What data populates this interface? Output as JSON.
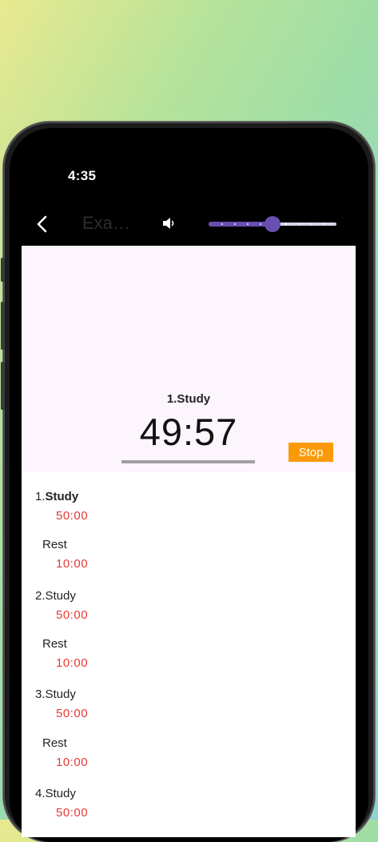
{
  "status": {
    "time": "4:35"
  },
  "appbar": {
    "title": "Exam...",
    "volume_level": 0.5
  },
  "timer": {
    "current_label": "1.Study",
    "countdown": "49:57",
    "stop_label": "Stop"
  },
  "list": [
    {
      "title": "1.",
      "title_bold": "Study",
      "time": "50:00",
      "kind": "study"
    },
    {
      "title": "Rest",
      "title_bold": "",
      "time": "10:00",
      "kind": "rest"
    },
    {
      "title": "2.Study",
      "title_bold": "",
      "time": "50:00",
      "kind": "study"
    },
    {
      "title": "Rest",
      "title_bold": "",
      "time": "10:00",
      "kind": "rest"
    },
    {
      "title": "3.Study",
      "title_bold": "",
      "time": "50:00",
      "kind": "study"
    },
    {
      "title": "Rest",
      "title_bold": "",
      "time": "10:00",
      "kind": "rest"
    },
    {
      "title": "4.Study",
      "title_bold": "",
      "time": "50:00",
      "kind": "study"
    }
  ],
  "colors": {
    "accent": "#6a4fb3",
    "stop": "#fb9a09",
    "time": "#e53935",
    "panel": "#fdf5fd"
  },
  "icons": {
    "back": "chevron-left-icon",
    "volume": "speaker-icon"
  }
}
